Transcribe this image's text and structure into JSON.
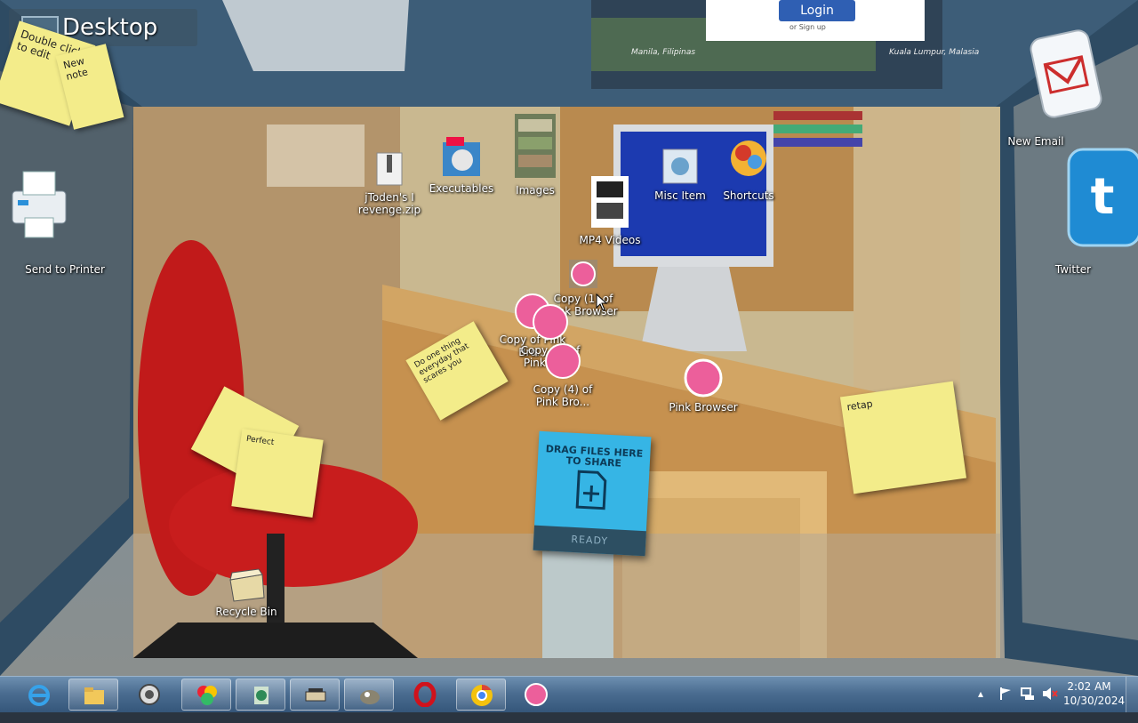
{
  "desktop_label": "Desktop",
  "top_card": {
    "login": "Login",
    "signup": "or Sign up",
    "city1": "Manila, Filipinas",
    "city2": "Kuala Lumpur, Malasia"
  },
  "left_icons": [
    {
      "label": "Send to Printer",
      "icon": "printer-icon"
    }
  ],
  "right_icons": [
    {
      "label": "New Email",
      "icon": "email-icon"
    },
    {
      "label": "Twitter",
      "icon": "twitter-icon"
    }
  ],
  "desktop_icons": [
    {
      "label": "jToden's I revenge.zip",
      "icon": "zip-file-icon"
    },
    {
      "label": "Executables",
      "icon": "executables-folder-icon"
    },
    {
      "label": "Images",
      "icon": "images-folder-icon"
    },
    {
      "label": "MP4 Videos",
      "icon": "video-folder-icon"
    },
    {
      "label": "Misc Item",
      "icon": "misc-folder-icon"
    },
    {
      "label": "Shortcuts",
      "icon": "shortcuts-folder-icon"
    },
    {
      "label": "Copy (1) of Pink Browser",
      "icon": "pink-browser-icon"
    },
    {
      "label": "Copy of Pink Bro...",
      "icon": "pink-browser-icon"
    },
    {
      "label": "Copy (3) of Pink Bro...",
      "icon": "pink-browser-icon"
    },
    {
      "label": "Copy (4) of Pink Bro...",
      "icon": "pink-browser-icon"
    },
    {
      "label": "Pink Browser",
      "icon": "pink-browser-icon"
    },
    {
      "label": "Recycle Bin",
      "icon": "recycle-bin-icon"
    }
  ],
  "stickies": [
    {
      "text": "Double click to edit"
    },
    {
      "text": "New note"
    },
    {
      "text": "Do one thing everyday that scares you"
    },
    {
      "text": "retap"
    },
    {
      "text": "Perfect"
    }
  ],
  "dropzone": {
    "title": "DRAG FILES HERE TO SHARE",
    "status": "READY"
  },
  "taskbar": {
    "items": [
      {
        "name": "internet-explorer",
        "icon": "ie-icon",
        "open": false
      },
      {
        "name": "file-explorer",
        "icon": "folder-icon",
        "open": true
      },
      {
        "name": "media-player",
        "icon": "media-icon",
        "open": false
      },
      {
        "name": "colorful-app",
        "icon": "app-icon",
        "open": true
      },
      {
        "name": "network-app",
        "icon": "network-icon",
        "open": true
      },
      {
        "name": "scanner-app",
        "icon": "scanner-icon",
        "open": true
      },
      {
        "name": "gimp",
        "icon": "gimp-icon",
        "open": true
      },
      {
        "name": "opera",
        "icon": "opera-icon",
        "open": false
      },
      {
        "name": "chrome",
        "icon": "chrome-icon",
        "open": true
      },
      {
        "name": "pink-browser",
        "icon": "pink-browser-icon",
        "open": false
      }
    ],
    "time": "2:02 AM",
    "date": "10/30/2024"
  }
}
